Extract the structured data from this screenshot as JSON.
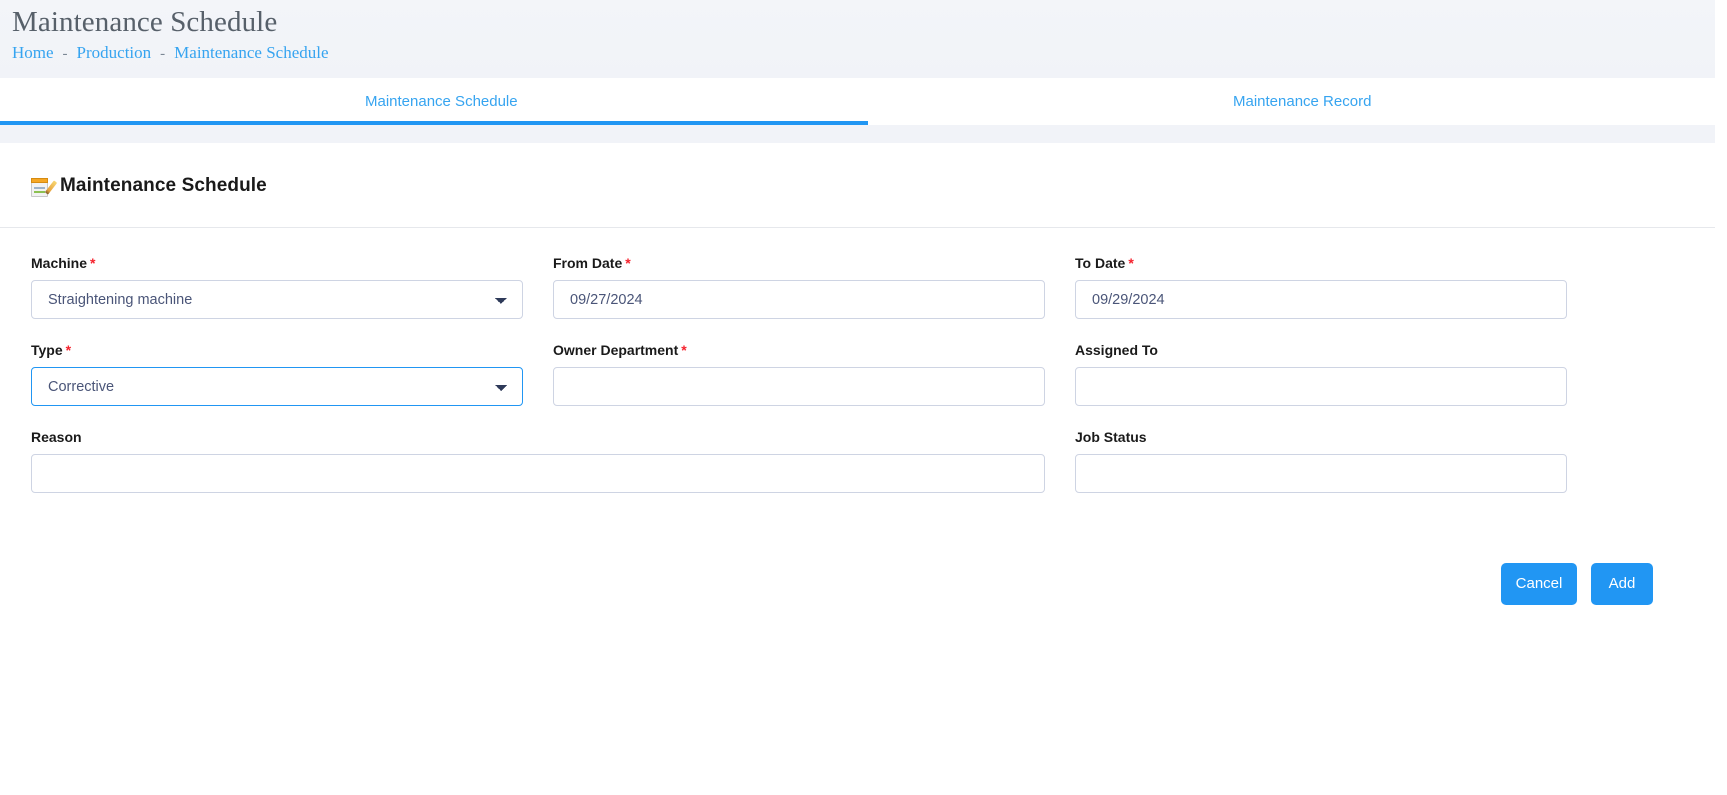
{
  "header": {
    "title": "Maintenance Schedule",
    "breadcrumb": [
      {
        "label": "Home"
      },
      {
        "label": "Production"
      },
      {
        "label": "Maintenance Schedule"
      }
    ],
    "separator": "-"
  },
  "tabs": [
    {
      "label": "Maintenance Schedule",
      "active": true
    },
    {
      "label": "Maintenance Record",
      "active": false
    }
  ],
  "card": {
    "icon": "memo-icon",
    "title": "Maintenance Schedule"
  },
  "form": {
    "machine": {
      "label": "Machine",
      "required": "*",
      "value": "Straightening machine",
      "icon": "chevron-down-icon"
    },
    "from_date": {
      "label": "From Date",
      "required": "*",
      "value": "09/27/2024",
      "placeholder": "09/27/2024"
    },
    "to_date": {
      "label": "To Date",
      "required": "*",
      "value": "09/29/2024",
      "placeholder": "09/29/2024"
    },
    "type": {
      "label": "Type",
      "required": "*",
      "value": "Corrective",
      "icon": "chevron-down-icon",
      "focused": true
    },
    "owner_department": {
      "label": "Owner Department",
      "required": "*",
      "value": "",
      "placeholder": ""
    },
    "assigned_to": {
      "label": "Assigned To",
      "required": "",
      "value": "",
      "placeholder": ""
    },
    "reason": {
      "label": "Reason",
      "required": "",
      "value": "",
      "placeholder": ""
    },
    "job_status": {
      "label": "Job Status",
      "required": "",
      "value": "",
      "placeholder": ""
    }
  },
  "actions": {
    "cancel_label": "Cancel",
    "add_label": "Add"
  },
  "colors": {
    "accent": "#2196f3",
    "link": "#36a4f0",
    "required": "#f5222d",
    "page_bg": "#f1f3f8",
    "field_text": "#4a5578",
    "border": "#ced4e3"
  }
}
